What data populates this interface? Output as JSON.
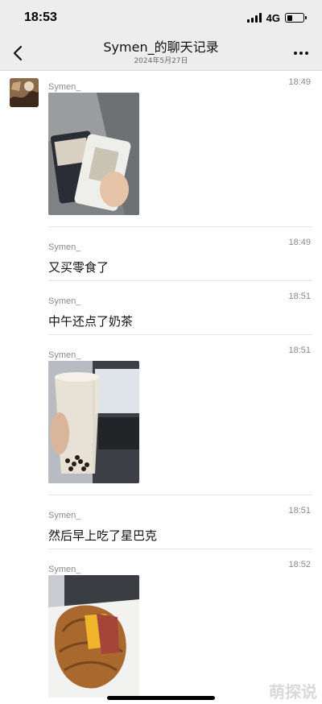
{
  "status_bar": {
    "time": "18:53",
    "network": "4G"
  },
  "nav": {
    "title": "Symen_的聊天记录",
    "subtitle": "2024年5月27日",
    "back_icon": "chevron-left-icon",
    "more_icon": "more-dots-icon"
  },
  "messages": [
    {
      "sender": "Symen_",
      "time": "18:49",
      "type": "image",
      "text": ""
    },
    {
      "sender": "Symen_",
      "time": "18:49",
      "type": "text",
      "text": "又买零食了"
    },
    {
      "sender": "Symen_",
      "time": "18:51",
      "type": "text",
      "text": "中午还点了奶茶"
    },
    {
      "sender": "Symen_",
      "time": "18:51",
      "type": "image",
      "text": ""
    },
    {
      "sender": "Symen_",
      "time": "18:51",
      "type": "text",
      "text": "然后早上吃了星巴克"
    },
    {
      "sender": "Symen_",
      "time": "18:52",
      "type": "image",
      "text": ""
    }
  ],
  "watermark": "萌探说",
  "colors": {
    "header_bg": "#ededed",
    "meta_text": "#8a8a8a",
    "divider": "#e6e6e6"
  }
}
